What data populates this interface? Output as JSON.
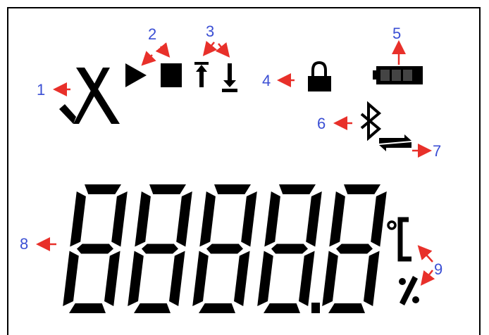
{
  "colors": {
    "background": "#ffffff",
    "frame": "#000000",
    "segment": "#000000",
    "callout_number": "#3b4fd4",
    "arrow": "#e8302a"
  },
  "callouts": [
    {
      "number": "1",
      "icon": "check-cross-icon"
    },
    {
      "number": "2",
      "icon": "play-stop-icon"
    },
    {
      "number": "3",
      "icon": "upload-download-icon"
    },
    {
      "number": "4",
      "icon": "lock-icon"
    },
    {
      "number": "5",
      "icon": "battery-icon"
    },
    {
      "number": "6",
      "icon": "bluetooth-icon"
    },
    {
      "number": "7",
      "icon": "transfer-icon"
    },
    {
      "number": "8",
      "icon": "seven-segment-digits"
    },
    {
      "number": "9",
      "icon": "unit-icons"
    }
  ],
  "units": {
    "celsius": "℃",
    "percent": "%"
  }
}
